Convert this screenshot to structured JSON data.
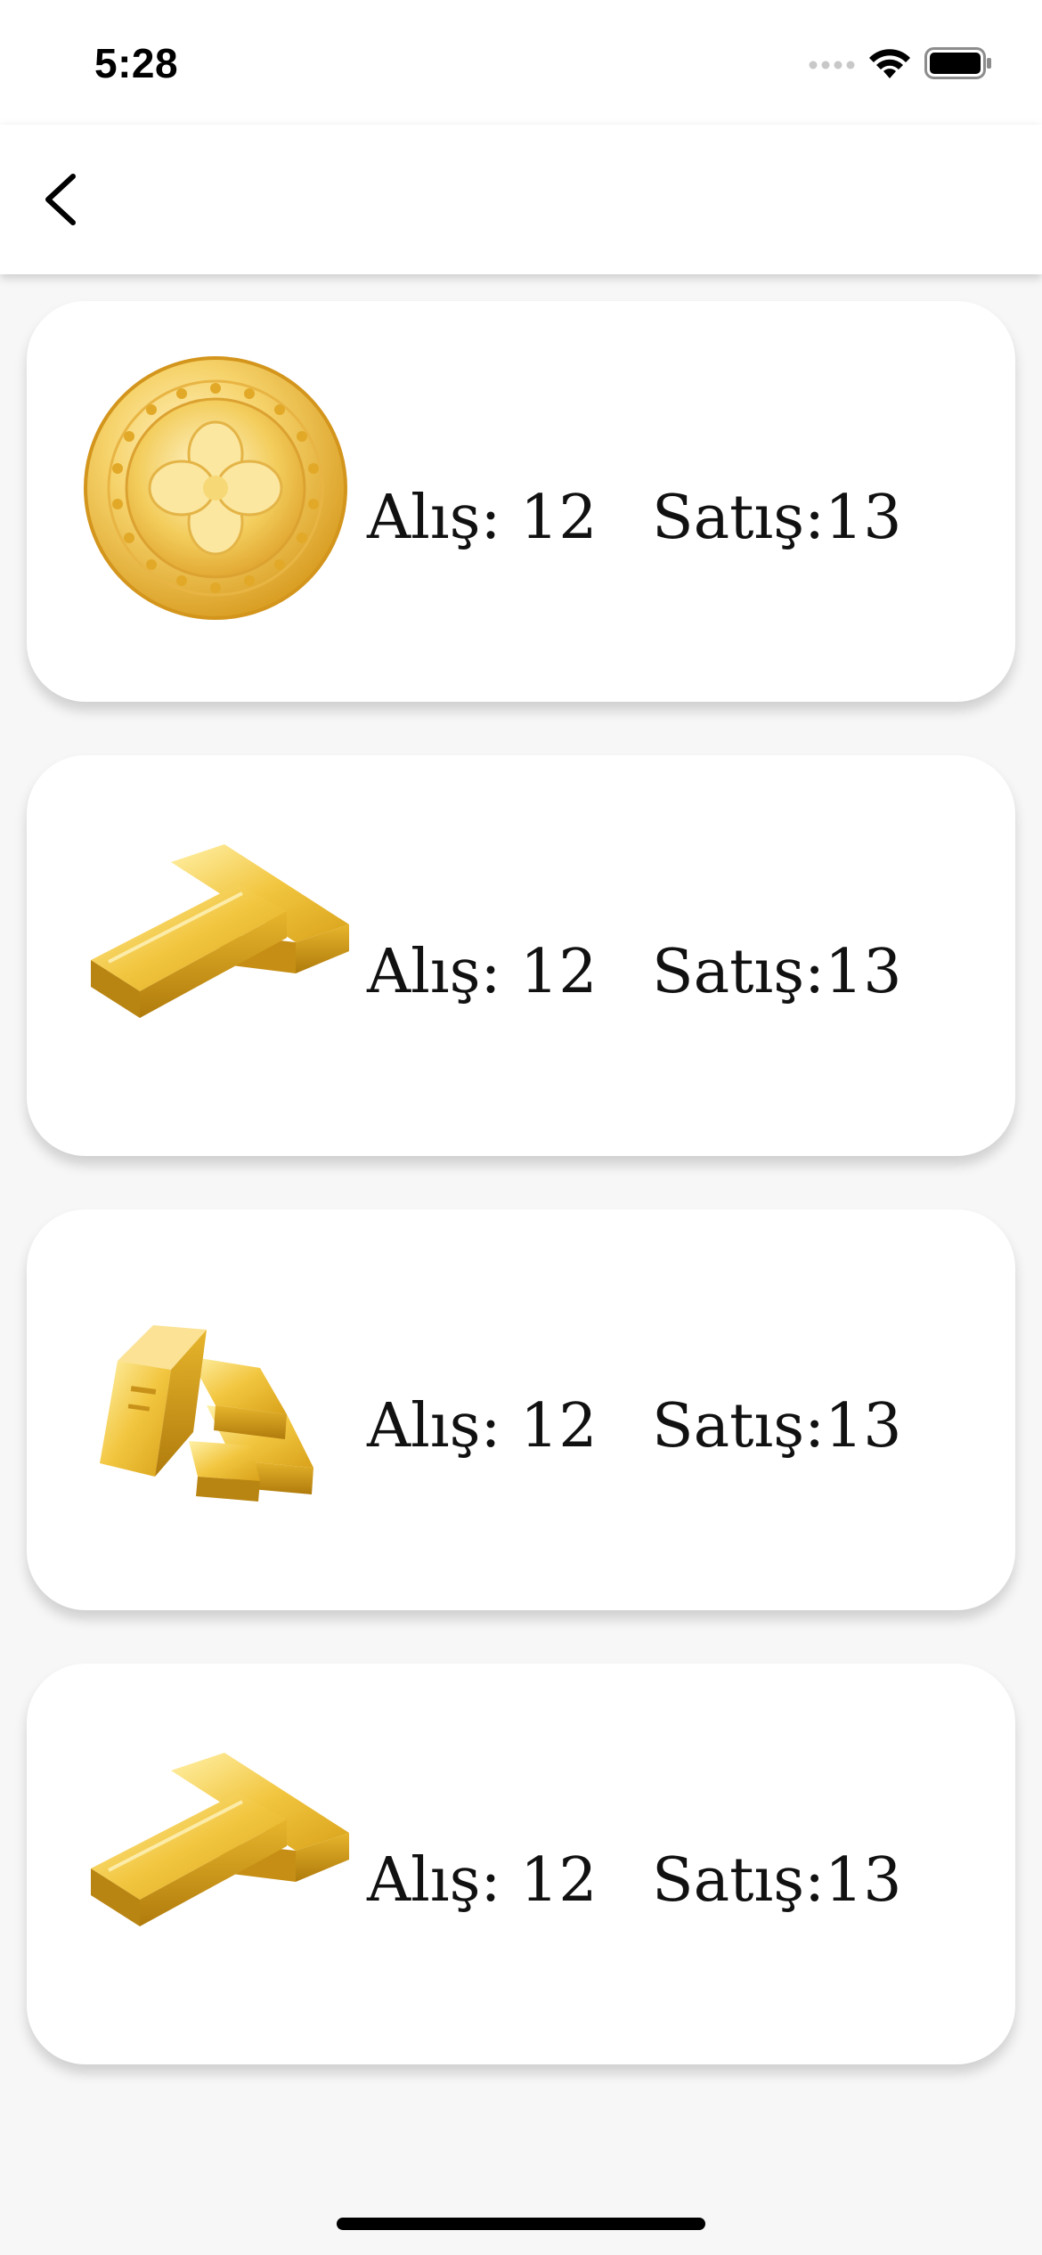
{
  "status_bar": {
    "time": "5:28",
    "icons": [
      "signal-icon",
      "wifi-icon",
      "battery-icon"
    ]
  },
  "nav_bar": {
    "back_icon": "chevron-left-icon"
  },
  "items": [
    {
      "image": "gold-coin-icon",
      "buy_label": "Alış: 12",
      "sell_label": "Satış:13"
    },
    {
      "image": "gold-bars-icon",
      "buy_label": "Alış: 12",
      "sell_label": "Satış:13"
    },
    {
      "image": "gold-bar-stack-icon",
      "buy_label": "Alış: 12",
      "sell_label": "Satış:13"
    },
    {
      "image": "gold-bars-icon",
      "buy_label": "Alış: 12",
      "sell_label": "Satış:13"
    }
  ],
  "colors": {
    "background": "#f7f7f7",
    "card": "#ffffff",
    "gold": "#e9b93a",
    "text": "#111111"
  }
}
